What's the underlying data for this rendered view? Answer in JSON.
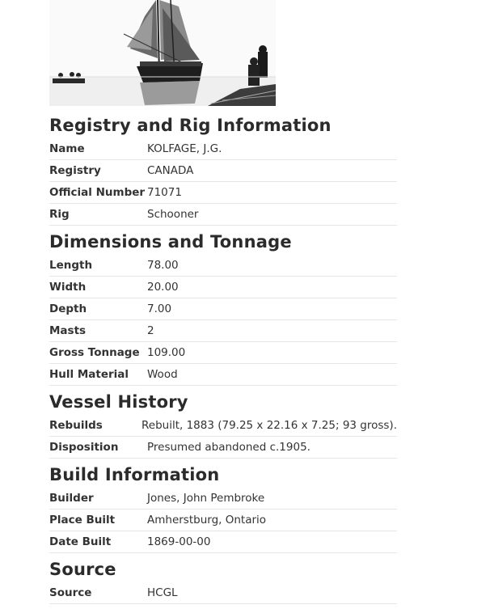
{
  "photo": {
    "alt_icon": "schooner-photo"
  },
  "sections": [
    {
      "title": "Registry and Rig Information",
      "rows": [
        {
          "label": "Name",
          "value": "KOLFAGE, J.G."
        },
        {
          "label": "Registry",
          "value": "CANADA"
        },
        {
          "label": "Official Number",
          "value": "71071"
        },
        {
          "label": "Rig",
          "value": "Schooner"
        }
      ]
    },
    {
      "title": "Dimensions and Tonnage",
      "rows": [
        {
          "label": "Length",
          "value": "78.00"
        },
        {
          "label": "Width",
          "value": "20.00"
        },
        {
          "label": "Depth",
          "value": "7.00"
        },
        {
          "label": "Masts",
          "value": "2"
        },
        {
          "label": "Gross Tonnage",
          "value": "109.00"
        },
        {
          "label": "Hull Material",
          "value": "Wood"
        }
      ]
    },
    {
      "title": "Vessel History",
      "rows": [
        {
          "label": "Rebuilds",
          "value": "Rebuilt, 1883 (79.25 x 22.16 x 7.25; 93 gross)."
        },
        {
          "label": "Disposition",
          "value": "Presumed abandoned c.1905."
        }
      ]
    },
    {
      "title": "Build Information",
      "rows": [
        {
          "label": "Builder",
          "value": "Jones, John Pembroke"
        },
        {
          "label": "Place Built",
          "value": "Amherstburg, Ontario"
        },
        {
          "label": "Date Built",
          "value": "1869-00-00"
        }
      ]
    },
    {
      "title": "Source",
      "rows": [
        {
          "label": "Source",
          "value": "HCGL"
        }
      ]
    }
  ]
}
